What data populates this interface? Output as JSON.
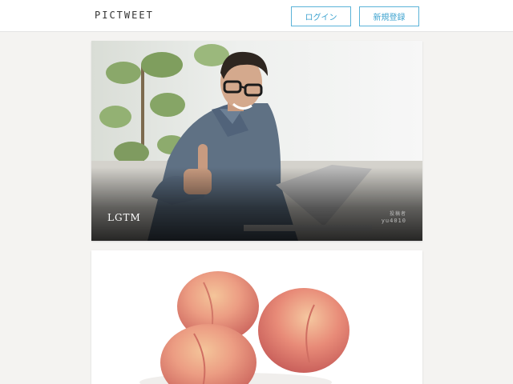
{
  "header": {
    "logo": "PICTWEET",
    "login_label": "ログイン",
    "signup_label": "新規登録"
  },
  "tweets": [
    {
      "text": "LGTM",
      "author_label": "投稿者",
      "author": "yu4010"
    },
    {
      "text": "",
      "author_label": "",
      "author": ""
    }
  ],
  "colors": {
    "button_border": "#5bb3d8",
    "button_text": "#3ba2cf",
    "background": "#f4f3f1"
  }
}
